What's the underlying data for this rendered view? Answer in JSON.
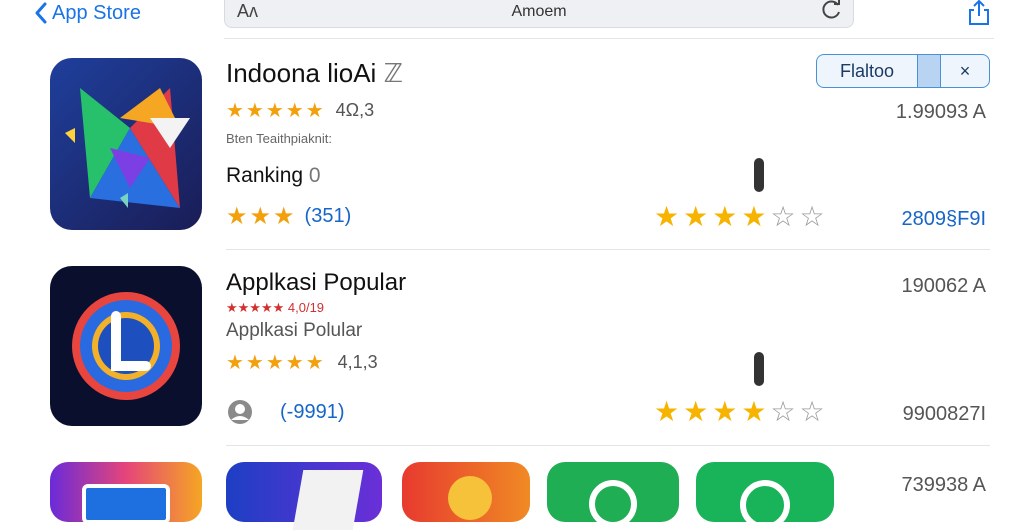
{
  "topbar": {
    "back_label": "App Store",
    "search_prefix": "Aʌ",
    "search_query": "Amoem"
  },
  "apps": [
    {
      "title": "Indoona lioAi",
      "title_extra": "ℤ",
      "rating_value": "4Ω,3",
      "subtitle": "Bten  Teaithpiaknit:",
      "ranking_label": "Ranking",
      "ranking_value": "0",
      "review_count": "(351)",
      "right_number": "1.99093 A",
      "right_blue": "2809§F9I",
      "segment_label": "Flaltoo",
      "segment_close": "×"
    },
    {
      "title": "Applkasi  Popular",
      "red_text": "★★★★★ 4,0/19",
      "subtitle": "Applkasi Polular",
      "rating_value": "4,1,3",
      "review_count": "(-9991)",
      "right_number": "190062 A",
      "right_gray": "9900827I"
    },
    {
      "right_number": "739938 A"
    }
  ],
  "colors": {
    "accent": "#1a73e8",
    "star": "#f2a10d",
    "blue_text": "#1766c7"
  }
}
